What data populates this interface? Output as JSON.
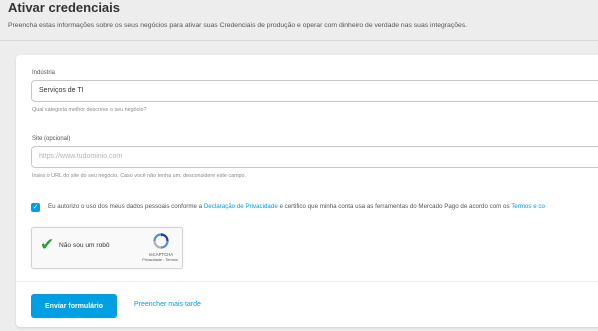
{
  "header": {
    "title": "Ativar credenciais",
    "subtitle": "Preencha estas informações sobre os seus negócios para ativar suas Credenciais de produção e operar com dinheiro de verdade nas suas integrações."
  },
  "form": {
    "industry": {
      "label": "Indústria",
      "value": "Serviços de TI",
      "help": "Qual categoria melhor descreve o seu negócio?"
    },
    "site": {
      "label": "Site (opcional)",
      "placeholder": "https://www.tudominio.com",
      "help": "Insira o URL do site do seu negócio. Caso você não tenha um, desconsidere este campo."
    },
    "consent": {
      "checked": true,
      "text_before": "Eu autorizo o uso dos meus dados pessoais conforme a ",
      "privacy_link": "Declaração de Privacidade",
      "text_middle": " e certifico que minha conta usa as ferramentas do Mercado Pago de acordo com os ",
      "terms_link": "Termos e co"
    },
    "recaptcha": {
      "label": "Não sou um robô",
      "brand": "reCAPTCHA",
      "terms": "Privacidade - Termos"
    }
  },
  "actions": {
    "submit_label": "Enviar formulário",
    "later_label": "Preencher mais tarde"
  },
  "colors": {
    "accent": "#009ee3",
    "check_green": "#2e9c3f",
    "background": "#ededed"
  }
}
